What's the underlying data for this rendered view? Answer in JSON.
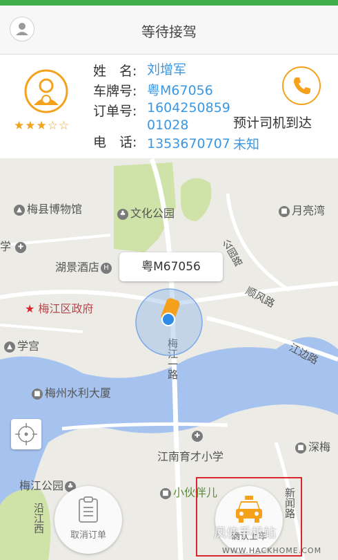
{
  "header": {
    "title": "等待接驾"
  },
  "driver": {
    "rating_stars": "★★★☆☆",
    "labels": {
      "name": "姓　名:",
      "plate": "车牌号:",
      "order": "订单号:",
      "phone": "电　话:"
    },
    "name": "刘增军",
    "plate": "粤M67056",
    "order_line1": "1604250859",
    "order_line2": "01028",
    "phone": "1353670707",
    "eta_label": "预计司机到达",
    "eta_value": "未知"
  },
  "map": {
    "pois": [
      "梅县博物馆",
      "文化公园",
      "月亮湾",
      "学",
      "湖景酒店",
      "梅江区政府",
      "学宫",
      "梅州水利大厦",
      "江南育才小学",
      "深梅",
      "梅江公园",
      "小伙伴儿",
      "沿江西",
      "新闻路",
      "梅江一路",
      "顺风路",
      "江边路",
      "公园路"
    ],
    "car_plate_bubble": "粤M67056"
  },
  "actions": {
    "cancel_label": "取消订单",
    "taxi_label": "确认上车"
  },
  "watermark": {
    "text": "凤侠手机站",
    "url": "WWW.HACKHOME.COM"
  },
  "colors": {
    "accent_orange": "#f5a11c",
    "link_blue": "#3a97e3",
    "top_green": "#3fae49",
    "highlight_red": "#d9262c"
  }
}
